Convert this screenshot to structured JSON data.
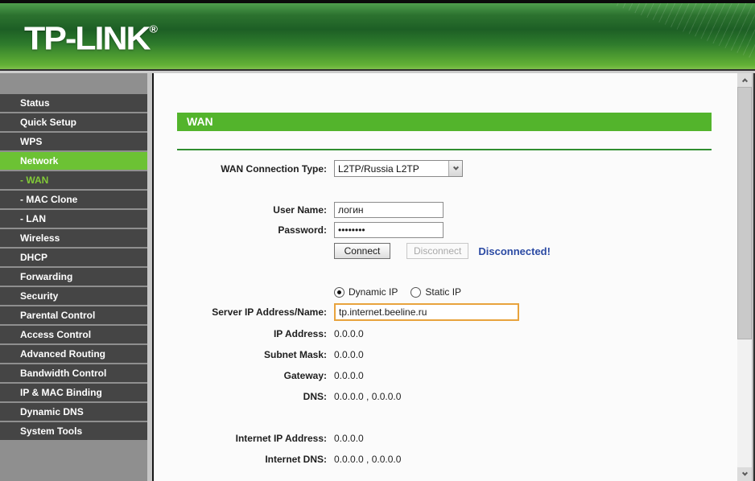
{
  "header": {
    "logo_text": "TP-LINK",
    "registered_mark": "®"
  },
  "sidebar": {
    "items": [
      {
        "label": "Status"
      },
      {
        "label": "Quick Setup"
      },
      {
        "label": "WPS"
      },
      {
        "label": "Network",
        "active": true
      },
      {
        "label": "- WAN",
        "sub": true,
        "selected": true
      },
      {
        "label": "- MAC Clone",
        "sub": true
      },
      {
        "label": "- LAN",
        "sub": true
      },
      {
        "label": "Wireless"
      },
      {
        "label": "DHCP"
      },
      {
        "label": "Forwarding"
      },
      {
        "label": "Security"
      },
      {
        "label": "Parental Control"
      },
      {
        "label": "Access Control"
      },
      {
        "label": "Advanced Routing"
      },
      {
        "label": "Bandwidth Control"
      },
      {
        "label": "IP & MAC Binding"
      },
      {
        "label": "Dynamic DNS"
      },
      {
        "label": "System Tools"
      }
    ]
  },
  "main": {
    "section_title": "WAN",
    "connection": {
      "label": "WAN Connection Type:",
      "selected_option": "L2TP/Russia L2TP"
    },
    "user_name": {
      "label": "User Name:",
      "value": "логин"
    },
    "password": {
      "label": "Password:",
      "value": "********"
    },
    "actions": {
      "connect_label": "Connect",
      "disconnect_label": "Disconnect",
      "status_text": "Disconnected!"
    },
    "ip_mode": {
      "dynamic": {
        "label": "Dynamic IP",
        "selected": true
      },
      "static": {
        "label": "Static IP",
        "selected": false
      }
    },
    "server": {
      "label": "Server IP Address/Name:",
      "value": "tp.internet.beeline.ru"
    },
    "readonly_fields": [
      {
        "label": "IP Address:",
        "value": "0.0.0.0"
      },
      {
        "label": "Subnet Mask:",
        "value": "0.0.0.0"
      },
      {
        "label": "Gateway:",
        "value": "0.0.0.0"
      },
      {
        "label": "DNS:",
        "value": "0.0.0.0 , 0.0.0.0"
      },
      {
        "label": "Internet IP Address:",
        "value": "0.0.0.0"
      },
      {
        "label": "Internet DNS:",
        "value": "0.0.0.0 , 0.0.0.0"
      }
    ]
  },
  "icons": {
    "dropdown": "chevron-down-icon",
    "scroll_up": "chevron-up-icon",
    "scroll_down": "chevron-down-icon"
  },
  "colors": {
    "header_green_dark": "#1d5f25",
    "header_green_light": "#63b136",
    "accent_green": "#53b42c",
    "sidebar_active_green": "#6cc234",
    "sidebar_sub_selected_green": "#82ca38",
    "sidebar_item_bg": "#454545",
    "status_blue": "#2b4aa3",
    "focus_orange": "#e8a33d",
    "rule_green": "#2f8d2f"
  }
}
